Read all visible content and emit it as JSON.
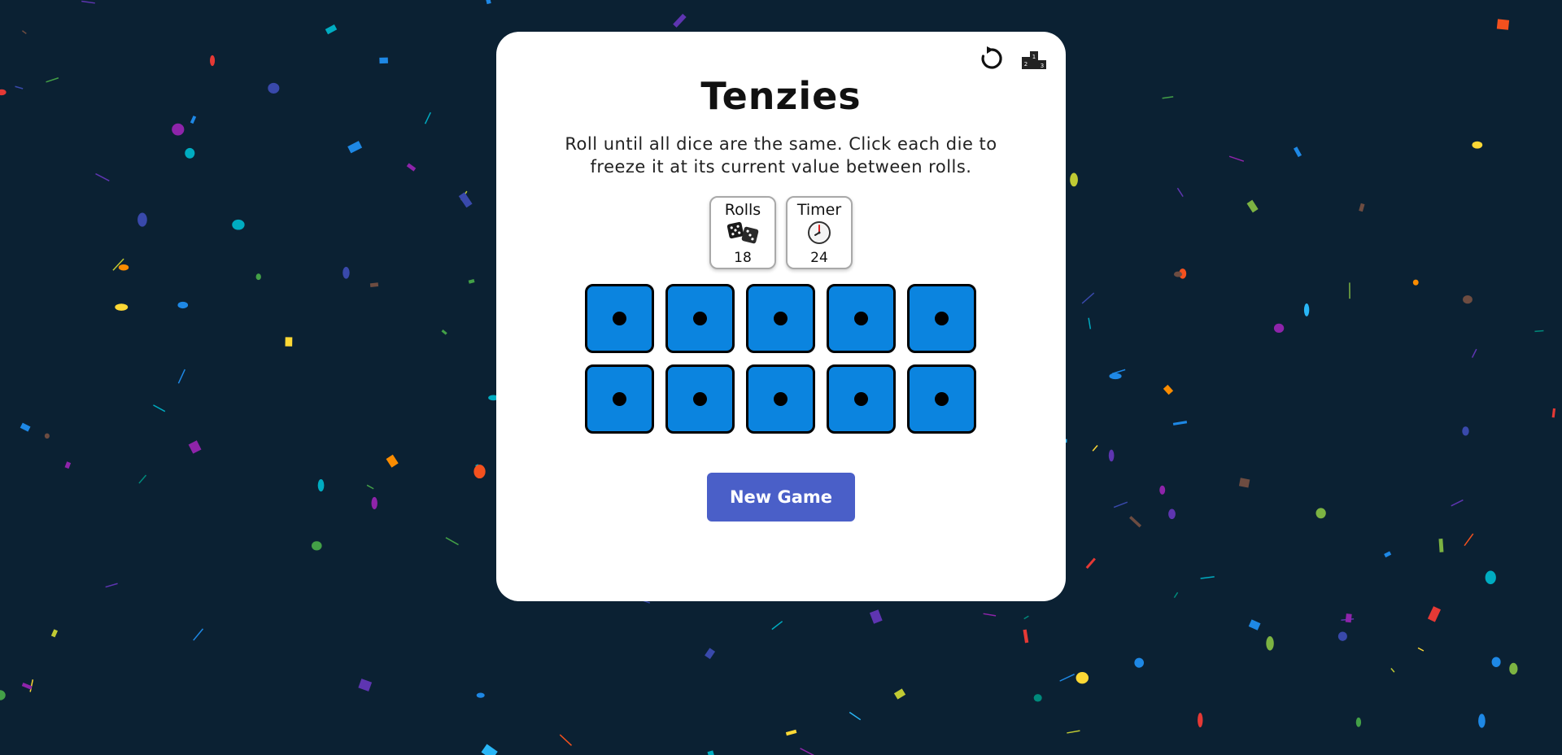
{
  "app": {
    "title": "Tenzies",
    "instructions": "Roll until all dice are the same. Click each die to freeze it at its current value between rolls."
  },
  "toolbar": {
    "reset_icon": "reset-icon",
    "leaderboard_icon": "podium-icon"
  },
  "stats": {
    "rolls": {
      "label": "Rolls",
      "value": "18",
      "icon": "dice-icon"
    },
    "timer": {
      "label": "Timer",
      "value": "24",
      "icon": "clock-icon"
    }
  },
  "dice": [
    {
      "value": 1,
      "held": true
    },
    {
      "value": 1,
      "held": true
    },
    {
      "value": 1,
      "held": true
    },
    {
      "value": 1,
      "held": true
    },
    {
      "value": 1,
      "held": true
    },
    {
      "value": 1,
      "held": true
    },
    {
      "value": 1,
      "held": true
    },
    {
      "value": 1,
      "held": true
    },
    {
      "value": 1,
      "held": true
    },
    {
      "value": 1,
      "held": true
    }
  ],
  "button": {
    "new_game_label": "New Game"
  },
  "colors": {
    "background": "#0b2133",
    "card": "#ffffff",
    "die_held": "#0b84df",
    "button": "#4a5fc8"
  }
}
